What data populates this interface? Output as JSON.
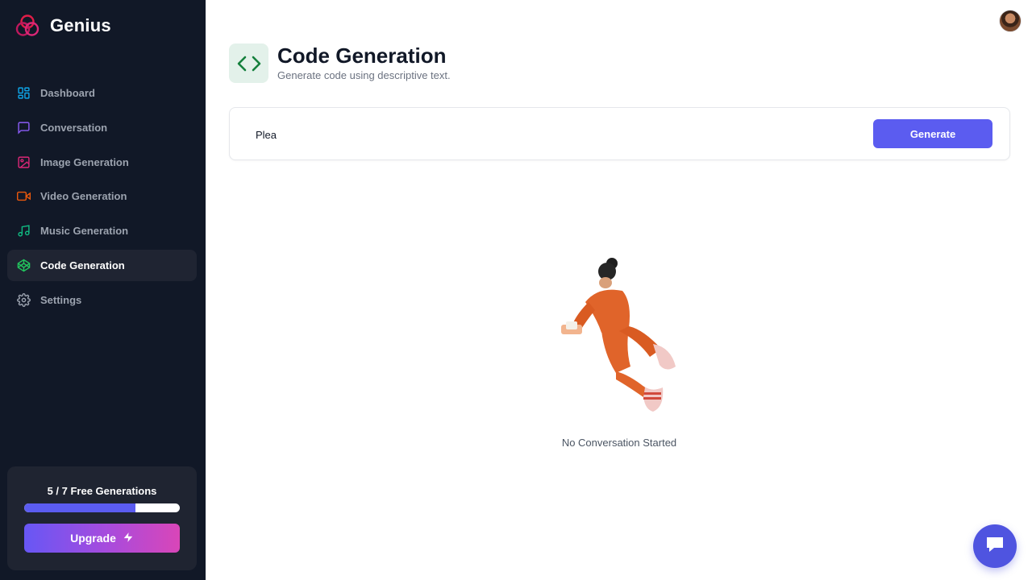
{
  "brand": {
    "name": "Genius",
    "logo_icon": "genius-logo-icon"
  },
  "sidebar": {
    "items": [
      {
        "label": "Dashboard",
        "icon": "dashboard-icon",
        "color": "#0ea5e9",
        "active": false
      },
      {
        "label": "Conversation",
        "icon": "chat-bubble-icon",
        "color": "#8b5cf6",
        "active": false
      },
      {
        "label": "Image Generation",
        "icon": "image-icon",
        "color": "#db2777",
        "active": false
      },
      {
        "label": "Video Generation",
        "icon": "video-icon",
        "color": "#ea580c",
        "active": false
      },
      {
        "label": "Music Generation",
        "icon": "music-icon",
        "color": "#10b981",
        "active": false
      },
      {
        "label": "Code Generation",
        "icon": "code-icon",
        "color": "#22c55e",
        "active": true
      },
      {
        "label": "Settings",
        "icon": "gear-icon",
        "color": "#9ca3af",
        "active": false
      }
    ]
  },
  "quota": {
    "label": "5 / 7 Free Generations",
    "used": 5,
    "total": 7,
    "fraction": 0.714,
    "upgrade_label": "Upgrade",
    "upgrade_icon": "lightning-icon"
  },
  "header": {
    "title": "Code Generation",
    "subtitle": "Generate code using descriptive text.",
    "icon": "code-brackets-icon",
    "icon_color": "#15803d",
    "icon_bg": "#e3f1ea"
  },
  "prompt": {
    "value": "Plea",
    "generate_label": "Generate"
  },
  "empty_state": {
    "text": "No Conversation Started",
    "illustration": "empty-state-illustration"
  },
  "colors": {
    "sidebar_bg": "#111827",
    "accent": "#5b5cf0",
    "chat_fab": "#4f54e0"
  }
}
